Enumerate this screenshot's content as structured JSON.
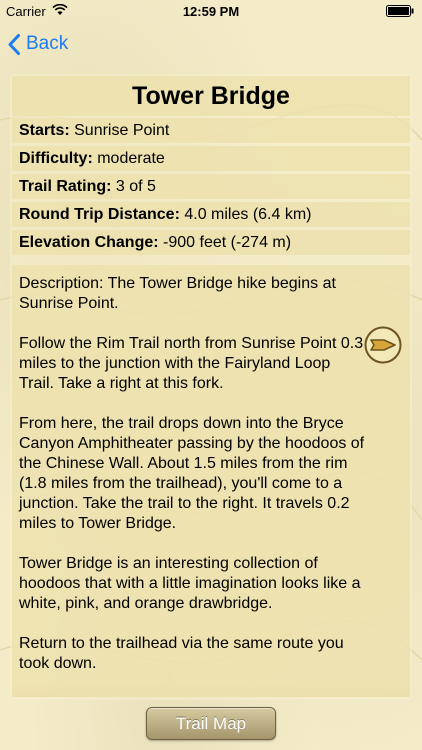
{
  "status_bar": {
    "carrier": "Carrier",
    "time": "12:59 PM"
  },
  "nav": {
    "back_label": "Back",
    "accent_color": "#1a7cf5"
  },
  "trail": {
    "title": "Tower Bridge",
    "details": [
      {
        "label": "Starts:",
        "value": " Sunrise Point"
      },
      {
        "label": "Difficulty:",
        "value": " moderate"
      },
      {
        "label": "Trail Rating:",
        "value": " 3 of 5"
      },
      {
        "label": "Round Trip Distance:",
        "value": " 4.0 miles (6.4 km)"
      },
      {
        "label": "Elevation Change:",
        "value": " -900 feet (-274 m)"
      }
    ],
    "description_paragraphs": [
      "Description: The Tower Bridge hike begins at Sunrise Point.",
      "Follow the Rim Trail north from Sunrise Point 0.3 miles to the junction with the Fairyland Loop Trail. Take a right at this fork.",
      "From here, the trail drops down into the Bryce Canyon Amphitheater passing by the hoodoos of the Chinese Wall. About 1.5 miles from the rim (1.8 miles from the trailhead), you'll come to a junction. Take the trail to the right. It travels 0.2 miles to Tower Bridge.",
      "Tower Bridge is an interesting collection of hoodoos that with a little imagination looks like a white, pink, and orange drawbridge.",
      "Return to the trailhead via the same route you took down."
    ]
  },
  "footer": {
    "trail_map_label": "Trail Map"
  }
}
